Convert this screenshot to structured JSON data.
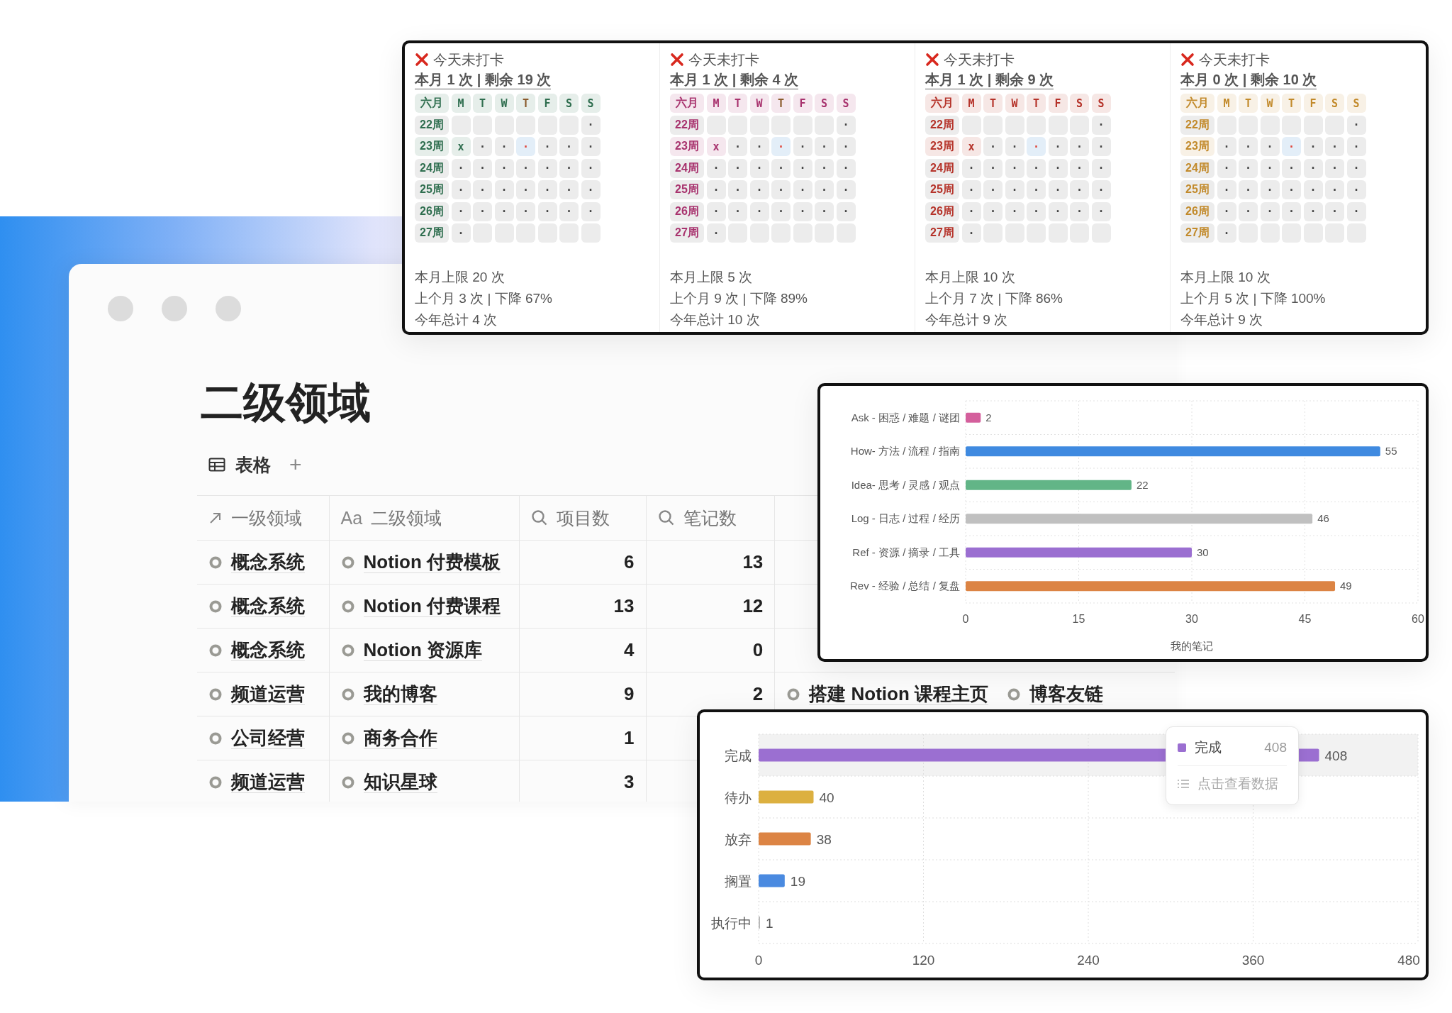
{
  "page": {
    "title": "二级领域",
    "view_tab": "表格",
    "add_view": "+"
  },
  "table": {
    "columns": [
      {
        "kind": "relation",
        "label": "一级领域"
      },
      {
        "kind": "title",
        "glyph": "Aa",
        "label": "二级领域"
      },
      {
        "kind": "rollup",
        "label": "项目数"
      },
      {
        "kind": "rollup",
        "label": "笔记数"
      }
    ],
    "rows": [
      {
        "domain": "概念系统",
        "area": "Notion 付费模板",
        "projects": "6",
        "notes": "13"
      },
      {
        "domain": "概念系统",
        "area": "Notion 付费课程",
        "projects": "13",
        "notes": "12"
      },
      {
        "domain": "概念系统",
        "area": "Notion 资源库",
        "projects": "4",
        "notes": "0"
      },
      {
        "domain": "频道运营",
        "area": "我的博客",
        "projects": "9",
        "notes": "2",
        "links": [
          "搭建 Notion 课程主页",
          "博客友链"
        ]
      },
      {
        "domain": "公司经营",
        "area": "商务合作",
        "projects": "1"
      },
      {
        "domain": "频道运营",
        "area": "知识星球",
        "projects": "3"
      }
    ]
  },
  "habits": {
    "cards": [
      {
        "status": "今天未打卡",
        "summary": "本月 1 次 | 剩余 19 次",
        "color": "#2f6e4f",
        "month": "六月",
        "days": [
          {
            "label": "M",
            "today": false
          },
          {
            "label": "T",
            "today": false
          },
          {
            "label": "W",
            "today": false
          },
          {
            "label": "T",
            "today": true
          },
          {
            "label": "F",
            "today": false
          },
          {
            "label": "S",
            "today": false
          },
          {
            "label": "S",
            "today": false
          }
        ],
        "weeks": [
          {
            "label": "22周",
            "current": false,
            "cells": [
              {
                "kind": "blank"
              },
              {
                "kind": "blank"
              },
              {
                "kind": "blank"
              },
              {
                "kind": "blank"
              },
              {
                "kind": "blank"
              },
              {
                "kind": "blank"
              },
              {
                "kind": "open",
                "text": "·"
              }
            ]
          },
          {
            "label": "23周",
            "current": true,
            "cells": [
              {
                "kind": "done",
                "text": "x"
              },
              {
                "kind": "open",
                "text": "·"
              },
              {
                "kind": "open",
                "text": "·"
              },
              {
                "kind": "today",
                "text": "·"
              },
              {
                "kind": "open",
                "text": "·"
              },
              {
                "kind": "open",
                "text": "·"
              },
              {
                "kind": "open",
                "text": "·"
              }
            ]
          },
          {
            "label": "24周",
            "current": false,
            "cells": [
              {
                "kind": "open",
                "text": "·"
              },
              {
                "kind": "open",
                "text": "·"
              },
              {
                "kind": "open",
                "text": "·"
              },
              {
                "kind": "open",
                "text": "·"
              },
              {
                "kind": "open",
                "text": "·"
              },
              {
                "kind": "open",
                "text": "·"
              },
              {
                "kind": "open",
                "text": "·"
              }
            ]
          },
          {
            "label": "25周",
            "current": false,
            "cells": [
              {
                "kind": "open",
                "text": "·"
              },
              {
                "kind": "open",
                "text": "·"
              },
              {
                "kind": "open",
                "text": "·"
              },
              {
                "kind": "open",
                "text": "·"
              },
              {
                "kind": "open",
                "text": "·"
              },
              {
                "kind": "open",
                "text": "·"
              },
              {
                "kind": "open",
                "text": "·"
              }
            ]
          },
          {
            "label": "26周",
            "current": false,
            "cells": [
              {
                "kind": "open",
                "text": "·"
              },
              {
                "kind": "open",
                "text": "·"
              },
              {
                "kind": "open",
                "text": "·"
              },
              {
                "kind": "open",
                "text": "·"
              },
              {
                "kind": "open",
                "text": "·"
              },
              {
                "kind": "open",
                "text": "·"
              },
              {
                "kind": "open",
                "text": "·"
              }
            ]
          },
          {
            "label": "27周",
            "current": false,
            "cells": [
              {
                "kind": "open",
                "text": "·"
              },
              {
                "kind": "blank"
              },
              {
                "kind": "blank"
              },
              {
                "kind": "blank"
              },
              {
                "kind": "blank"
              },
              {
                "kind": "blank"
              },
              {
                "kind": "blank"
              }
            ]
          }
        ],
        "footer": [
          "本月上限 20 次",
          "上个月 3 次 | 下降 67%",
          "今年总计 4 次"
        ]
      },
      {
        "status": "今天未打卡",
        "summary": "本月 1 次 | 剩余 4 次",
        "color": "#a8336e",
        "month": "六月",
        "days": [
          {
            "label": "M",
            "today": false
          },
          {
            "label": "T",
            "today": false
          },
          {
            "label": "W",
            "today": false
          },
          {
            "label": "T",
            "today": true
          },
          {
            "label": "F",
            "today": false
          },
          {
            "label": "S",
            "today": false
          },
          {
            "label": "S",
            "today": false
          }
        ],
        "weeks": [
          {
            "label": "22周",
            "current": false,
            "cells": [
              {
                "kind": "blank"
              },
              {
                "kind": "blank"
              },
              {
                "kind": "blank"
              },
              {
                "kind": "blank"
              },
              {
                "kind": "blank"
              },
              {
                "kind": "blank"
              },
              {
                "kind": "open",
                "text": "·"
              }
            ]
          },
          {
            "label": "23周",
            "current": true,
            "cells": [
              {
                "kind": "done",
                "text": "x"
              },
              {
                "kind": "open",
                "text": "·"
              },
              {
                "kind": "open",
                "text": "·"
              },
              {
                "kind": "today",
                "text": "·"
              },
              {
                "kind": "open",
                "text": "·"
              },
              {
                "kind": "open",
                "text": "·"
              },
              {
                "kind": "open",
                "text": "·"
              }
            ]
          },
          {
            "label": "24周",
            "current": false,
            "cells": [
              {
                "kind": "open",
                "text": "·"
              },
              {
                "kind": "open",
                "text": "·"
              },
              {
                "kind": "open",
                "text": "·"
              },
              {
                "kind": "open",
                "text": "·"
              },
              {
                "kind": "open",
                "text": "·"
              },
              {
                "kind": "open",
                "text": "·"
              },
              {
                "kind": "open",
                "text": "·"
              }
            ]
          },
          {
            "label": "25周",
            "current": false,
            "cells": [
              {
                "kind": "open",
                "text": "·"
              },
              {
                "kind": "open",
                "text": "·"
              },
              {
                "kind": "open",
                "text": "·"
              },
              {
                "kind": "open",
                "text": "·"
              },
              {
                "kind": "open",
                "text": "·"
              },
              {
                "kind": "open",
                "text": "·"
              },
              {
                "kind": "open",
                "text": "·"
              }
            ]
          },
          {
            "label": "26周",
            "current": false,
            "cells": [
              {
                "kind": "open",
                "text": "·"
              },
              {
                "kind": "open",
                "text": "·"
              },
              {
                "kind": "open",
                "text": "·"
              },
              {
                "kind": "open",
                "text": "·"
              },
              {
                "kind": "open",
                "text": "·"
              },
              {
                "kind": "open",
                "text": "·"
              },
              {
                "kind": "open",
                "text": "·"
              }
            ]
          },
          {
            "label": "27周",
            "current": false,
            "cells": [
              {
                "kind": "open",
                "text": "·"
              },
              {
                "kind": "blank"
              },
              {
                "kind": "blank"
              },
              {
                "kind": "blank"
              },
              {
                "kind": "blank"
              },
              {
                "kind": "blank"
              },
              {
                "kind": "blank"
              }
            ]
          }
        ],
        "footer": [
          "本月上限 5 次",
          "上个月 9 次 | 下降 89%",
          "今年总计 10 次"
        ]
      },
      {
        "status": "今天未打卡",
        "summary": "本月 1 次 | 剩余 9 次",
        "color": "#b5332a",
        "month": "六月",
        "days": [
          {
            "label": "M",
            "today": false
          },
          {
            "label": "T",
            "today": false
          },
          {
            "label": "W",
            "today": false
          },
          {
            "label": "T",
            "today": false
          },
          {
            "label": "F",
            "today": false
          },
          {
            "label": "S",
            "today": false
          },
          {
            "label": "S",
            "today": false
          }
        ],
        "weeks": [
          {
            "label": "22周",
            "current": false,
            "cells": [
              {
                "kind": "blank"
              },
              {
                "kind": "blank"
              },
              {
                "kind": "blank"
              },
              {
                "kind": "blank"
              },
              {
                "kind": "blank"
              },
              {
                "kind": "blank"
              },
              {
                "kind": "open",
                "text": "·"
              }
            ]
          },
          {
            "label": "23周",
            "current": true,
            "cells": [
              {
                "kind": "done",
                "text": "x"
              },
              {
                "kind": "open",
                "text": "·"
              },
              {
                "kind": "open",
                "text": "·"
              },
              {
                "kind": "today",
                "text": "·"
              },
              {
                "kind": "open",
                "text": "·"
              },
              {
                "kind": "open",
                "text": "·"
              },
              {
                "kind": "open",
                "text": "·"
              }
            ]
          },
          {
            "label": "24周",
            "current": false,
            "cells": [
              {
                "kind": "open",
                "text": "·"
              },
              {
                "kind": "open",
                "text": "·"
              },
              {
                "kind": "open",
                "text": "·"
              },
              {
                "kind": "open",
                "text": "·"
              },
              {
                "kind": "open",
                "text": "·"
              },
              {
                "kind": "open",
                "text": "·"
              },
              {
                "kind": "open",
                "text": "·"
              }
            ]
          },
          {
            "label": "25周",
            "current": false,
            "cells": [
              {
                "kind": "open",
                "text": "·"
              },
              {
                "kind": "open",
                "text": "·"
              },
              {
                "kind": "open",
                "text": "·"
              },
              {
                "kind": "open",
                "text": "·"
              },
              {
                "kind": "open",
                "text": "·"
              },
              {
                "kind": "open",
                "text": "·"
              },
              {
                "kind": "open",
                "text": "·"
              }
            ]
          },
          {
            "label": "26周",
            "current": false,
            "cells": [
              {
                "kind": "open",
                "text": "·"
              },
              {
                "kind": "open",
                "text": "·"
              },
              {
                "kind": "open",
                "text": "·"
              },
              {
                "kind": "open",
                "text": "·"
              },
              {
                "kind": "open",
                "text": "·"
              },
              {
                "kind": "open",
                "text": "·"
              },
              {
                "kind": "open",
                "text": "·"
              }
            ]
          },
          {
            "label": "27周",
            "current": false,
            "cells": [
              {
                "kind": "open",
                "text": "·"
              },
              {
                "kind": "blank"
              },
              {
                "kind": "blank"
              },
              {
                "kind": "blank"
              },
              {
                "kind": "blank"
              },
              {
                "kind": "blank"
              },
              {
                "kind": "blank"
              }
            ]
          }
        ],
        "footer": [
          "本月上限 10 次",
          "上个月 7 次 | 下降 86%",
          "今年总计 9 次"
        ]
      },
      {
        "status": "今天未打卡",
        "summary": "本月 0 次 | 剩余 10 次",
        "color": "#c28a2b",
        "month": "六月",
        "days": [
          {
            "label": "M",
            "today": false
          },
          {
            "label": "T",
            "today": false
          },
          {
            "label": "W",
            "today": false
          },
          {
            "label": "T",
            "today": false
          },
          {
            "label": "F",
            "today": false
          },
          {
            "label": "S",
            "today": false
          },
          {
            "label": "S",
            "today": false
          }
        ],
        "weeks": [
          {
            "label": "22周",
            "current": false,
            "cells": [
              {
                "kind": "blank"
              },
              {
                "kind": "blank"
              },
              {
                "kind": "blank"
              },
              {
                "kind": "blank"
              },
              {
                "kind": "blank"
              },
              {
                "kind": "blank"
              },
              {
                "kind": "open",
                "text": "·"
              }
            ]
          },
          {
            "label": "23周",
            "current": true,
            "cells": [
              {
                "kind": "open",
                "text": "·"
              },
              {
                "kind": "open",
                "text": "·"
              },
              {
                "kind": "open",
                "text": "·"
              },
              {
                "kind": "today",
                "text": "·"
              },
              {
                "kind": "open",
                "text": "·"
              },
              {
                "kind": "open",
                "text": "·"
              },
              {
                "kind": "open",
                "text": "·"
              }
            ]
          },
          {
            "label": "24周",
            "current": false,
            "cells": [
              {
                "kind": "open",
                "text": "·"
              },
              {
                "kind": "open",
                "text": "·"
              },
              {
                "kind": "open",
                "text": "·"
              },
              {
                "kind": "open",
                "text": "·"
              },
              {
                "kind": "open",
                "text": "·"
              },
              {
                "kind": "open",
                "text": "·"
              },
              {
                "kind": "open",
                "text": "·"
              }
            ]
          },
          {
            "label": "25周",
            "current": false,
            "cells": [
              {
                "kind": "open",
                "text": "·"
              },
              {
                "kind": "open",
                "text": "·"
              },
              {
                "kind": "open",
                "text": "·"
              },
              {
                "kind": "open",
                "text": "·"
              },
              {
                "kind": "open",
                "text": "·"
              },
              {
                "kind": "open",
                "text": "·"
              },
              {
                "kind": "open",
                "text": "·"
              }
            ]
          },
          {
            "label": "26周",
            "current": false,
            "cells": [
              {
                "kind": "open",
                "text": "·"
              },
              {
                "kind": "open",
                "text": "·"
              },
              {
                "kind": "open",
                "text": "·"
              },
              {
                "kind": "open",
                "text": "·"
              },
              {
                "kind": "open",
                "text": "·"
              },
              {
                "kind": "open",
                "text": "·"
              },
              {
                "kind": "open",
                "text": "·"
              }
            ]
          },
          {
            "label": "27周",
            "current": false,
            "cells": [
              {
                "kind": "open",
                "text": "·"
              },
              {
                "kind": "blank"
              },
              {
                "kind": "blank"
              },
              {
                "kind": "blank"
              },
              {
                "kind": "blank"
              },
              {
                "kind": "blank"
              },
              {
                "kind": "blank"
              }
            ]
          }
        ],
        "footer": [
          "本月上限 10 次",
          "上个月 5 次 | 下降 100%",
          "今年总计 9 次"
        ]
      }
    ]
  },
  "notes_chart": {
    "chart_data": {
      "type": "bar",
      "orientation": "horizontal",
      "xlabel": "我的笔记",
      "categories": [
        "Ask - 困惑 / 难题 / 谜团",
        "How- 方法 / 流程 / 指南",
        "Idea- 思考 / 灵感 / 观点",
        "Log - 日志 / 过程 / 经历",
        "Ref - 资源 / 摘录 / 工具",
        "Rev - 经验 / 总结 / 复盘"
      ],
      "values": [
        2,
        55,
        22,
        46,
        30,
        49
      ],
      "xlim": [
        0,
        60
      ],
      "xticks": [
        0,
        15,
        30,
        45,
        60
      ],
      "grid": true,
      "data_labels": true
    },
    "bars": [
      {
        "color": "#d45f9c"
      },
      {
        "color": "#3f8ae0"
      },
      {
        "color": "#62b587"
      },
      {
        "color": "#c0c0c0"
      },
      {
        "color": "#9b6fd1"
      },
      {
        "color": "#dc8444"
      }
    ]
  },
  "status_chart": {
    "chart_data": {
      "type": "bar",
      "orientation": "horizontal",
      "categories": [
        "完成",
        "待办",
        "放弃",
        "搁置",
        "执行中"
      ],
      "values": [
        408,
        40,
        38,
        19,
        1
      ],
      "xlim": [
        0,
        480
      ],
      "xticks": [
        0,
        120,
        240,
        360,
        480
      ],
      "grid": true,
      "data_labels": true
    },
    "bars": [
      {
        "color": "#9b6fd1",
        "hovered": true
      },
      {
        "color": "#dcb040",
        "hovered": false
      },
      {
        "color": "#dc8444",
        "hovered": false
      },
      {
        "color": "#4a8ae0",
        "hovered": false
      },
      {
        "color": "#b8b8b8",
        "hovered": false
      }
    ],
    "tooltip": {
      "label": "完成",
      "value": "408",
      "color": "#9b6fd1",
      "action": "点击查看数据"
    }
  }
}
